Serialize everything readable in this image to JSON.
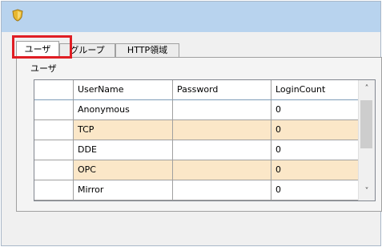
{
  "tabs": [
    {
      "label": "ユーザ"
    },
    {
      "label": "グループ"
    },
    {
      "label": "HTTP領域"
    }
  ],
  "group_label": "ユーザ",
  "table": {
    "columns": [
      "UserName",
      "Password",
      "LoginCount"
    ],
    "rows": [
      {
        "username": "Anonymous",
        "password": "",
        "login_count": "0"
      },
      {
        "username": "TCP",
        "password": "",
        "login_count": "0"
      },
      {
        "username": "DDE",
        "password": "",
        "login_count": "0"
      },
      {
        "username": "OPC",
        "password": "",
        "login_count": "0"
      },
      {
        "username": "Mirror",
        "password": "",
        "login_count": "0"
      }
    ]
  },
  "icons": {
    "app": "shield-icon",
    "scroll_up": "chevron-up-icon",
    "scroll_down": "chevron-down-icon"
  },
  "colors": {
    "title_bar": "#b8d3ee",
    "alt_row": "#fbe7c8",
    "highlight": "#e01e24"
  }
}
